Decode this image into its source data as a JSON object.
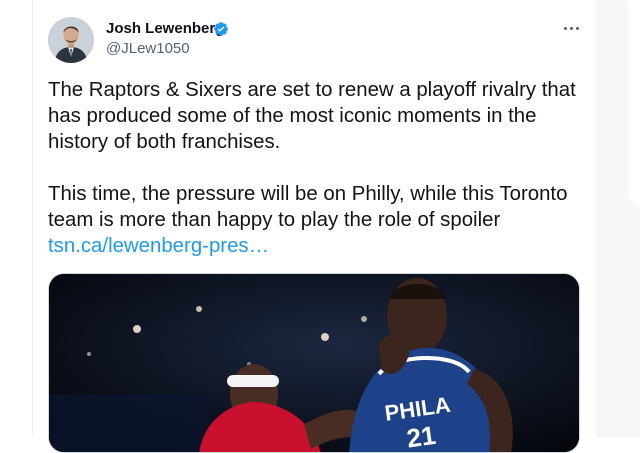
{
  "author": {
    "name": "Josh Lewenberg",
    "handle": "@JLew1050",
    "verified": true
  },
  "tweet": {
    "paragraph1": "The Raptors & Sixers are set to renew a playoff rivalry that has produced some of the most iconic moments in the history of both franchises.",
    "paragraph2": "This time, the pressure will be on Philly, while this Toronto team is more than happy to play the role of spoiler",
    "link": "tsn.ca/lewenberg-pres…"
  },
  "media": {
    "jersey_text": "PHILA",
    "jersey_number": "21"
  },
  "icons": {
    "verified": "verified-badge-icon",
    "more": "more-options-icon"
  },
  "colors": {
    "accent": "#1d9bf0",
    "text": "#0f1419",
    "muted": "#536471"
  }
}
